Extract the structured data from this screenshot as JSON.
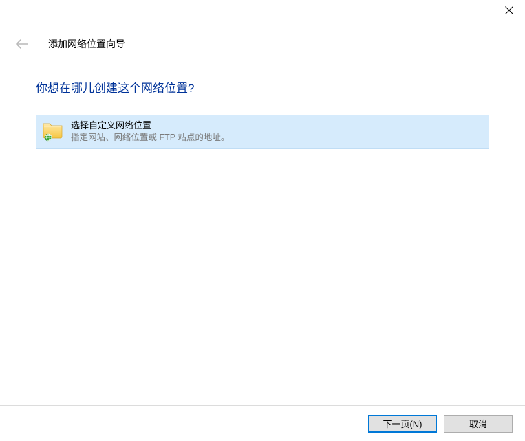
{
  "titlebar": {
    "close_label": "Close"
  },
  "header": {
    "back_label": "Back",
    "wizard_title": "添加网络位置向导"
  },
  "main": {
    "heading": "你想在哪儿创建这个网络位置?",
    "option": {
      "title": "选择自定义网络位置",
      "description": "指定网站、网络位置或 FTP 站点的地址。"
    }
  },
  "footer": {
    "next_label": "下一页(N)",
    "cancel_label": "取消"
  }
}
